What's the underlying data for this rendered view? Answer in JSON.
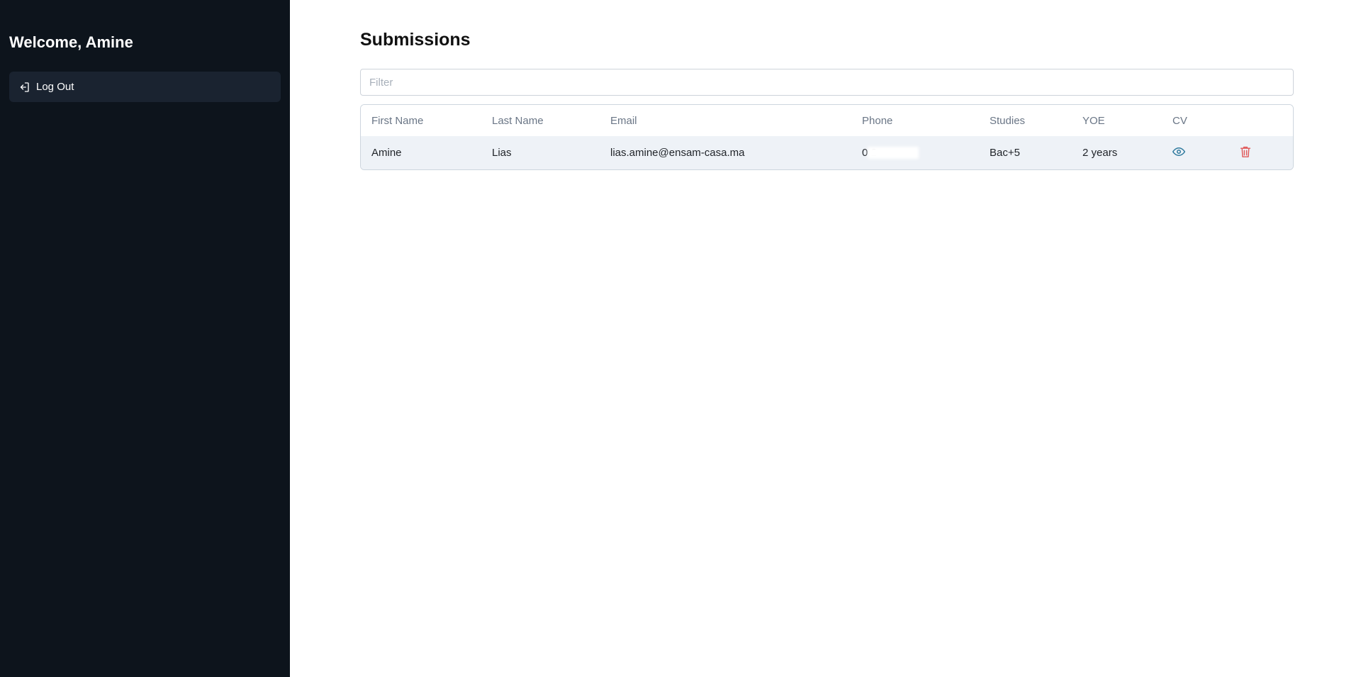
{
  "sidebar": {
    "welcome": "Welcome, Amine",
    "logout_label": "Log Out",
    "logout_icon": "log-out-icon"
  },
  "main": {
    "title": "Submissions",
    "filter": {
      "placeholder": "Filter",
      "value": ""
    },
    "table": {
      "headers": [
        "First Name",
        "Last Name",
        "Email",
        "Phone",
        "Studies",
        "YOE",
        "CV",
        ""
      ],
      "rows": [
        {
          "first_name": "Amine",
          "last_name": "Lias",
          "email": "lias.amine@ensam-casa.ma",
          "phone": "0          2",
          "studies": "Bac+5",
          "yoe": "2 years",
          "cv_icon": "eye-icon",
          "delete_icon": "trash-icon"
        }
      ]
    }
  },
  "colors": {
    "sidebar_bg": "#0d141c",
    "logout_bg": "#1a2330",
    "row_bg": "#eef2f7",
    "eye": "#2f7a9e",
    "trash": "#e05a5a"
  }
}
